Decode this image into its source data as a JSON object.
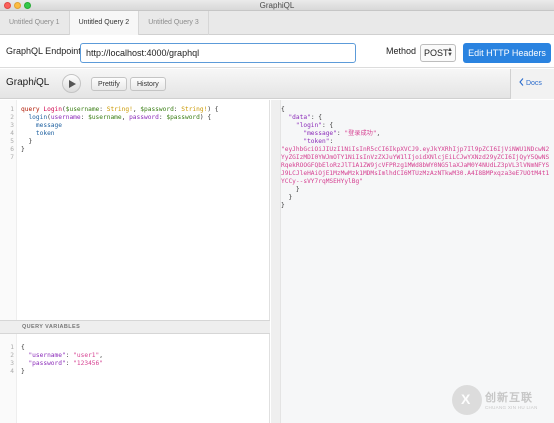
{
  "window": {
    "title": "GraphiQL"
  },
  "tabs": [
    {
      "label": "Untitled Query 1",
      "active": false
    },
    {
      "label": "Untitled Query 2",
      "active": true
    },
    {
      "label": "Untitled Query 3",
      "active": false
    }
  ],
  "endpoint": {
    "label": "GraphQL Endpoint",
    "value": "http://localhost:4000/graphql",
    "method_label": "Method",
    "method_value": "POST",
    "edit_headers_label": "Edit HTTP Headers"
  },
  "toolbar": {
    "brand_prefix": "Graph",
    "brand_italic": "i",
    "brand_suffix": "QL",
    "run_icon": "play-icon",
    "prettify_label": "Prettify",
    "history_label": "History",
    "docs_icon": "chevron-left-icon",
    "docs_label": "Docs"
  },
  "query_editor": {
    "line_numbers": [
      "1",
      "2",
      "3",
      "4",
      "5",
      "6",
      "7"
    ],
    "l1_keyword": "query",
    "l1_name": "Login",
    "l1_var1": "$username",
    "l1_type1": "String!",
    "l1_var2": "$password",
    "l1_type2": "String!",
    "l2_field": "login",
    "l2_arg1": "username",
    "l2_var1": "$username",
    "l2_arg2": "password",
    "l2_var2": "$password",
    "l3_field": "message",
    "l4_field": "token"
  },
  "variables": {
    "header": "QUERY VARIABLES",
    "line_numbers": [
      "1",
      "2",
      "3",
      "4"
    ],
    "username_key": "\"username\"",
    "username_value": "\"user1\"",
    "password_key": "\"password\"",
    "password_value": "\"123456\""
  },
  "result": {
    "data_key": "\"data\"",
    "login_key": "\"login\"",
    "message_key": "\"message\"",
    "message_value": "\"登录成功\"",
    "token_key": "\"token\"",
    "token_value": "\"eyJhbGciOiJIUzI1NiIsInR5cCI6IkpXVCJ9.eyJkYXRhIjp7Il9pZCI6IjViNWU1NDcwN2YyZGIzMDI0YWJmOTY1NiIsInVzZXJuYW1lIjoidXNlcjEiLCJwYXNzd29yZCI6IjQyY5QwNSRqekROOGFQbEloRzJlT1A1ZW9jcVFPRzg1MWd8bWY0NG5laXJaM0Y4NUdLZ3pVL3lVNmNFYSJ9LCJleHAiOjE1MzMwMzk1MDMsImlhdCI6MTUzMzAzNTkwM30.A4I8BMPxqza3eE7UOtM4t1YCCy--sVY7rqMSEHYylBg\""
  },
  "watermark": {
    "logo_letter": "X",
    "cn": "创新互联",
    "en": "CHUANG XIN HU LIAN"
  }
}
